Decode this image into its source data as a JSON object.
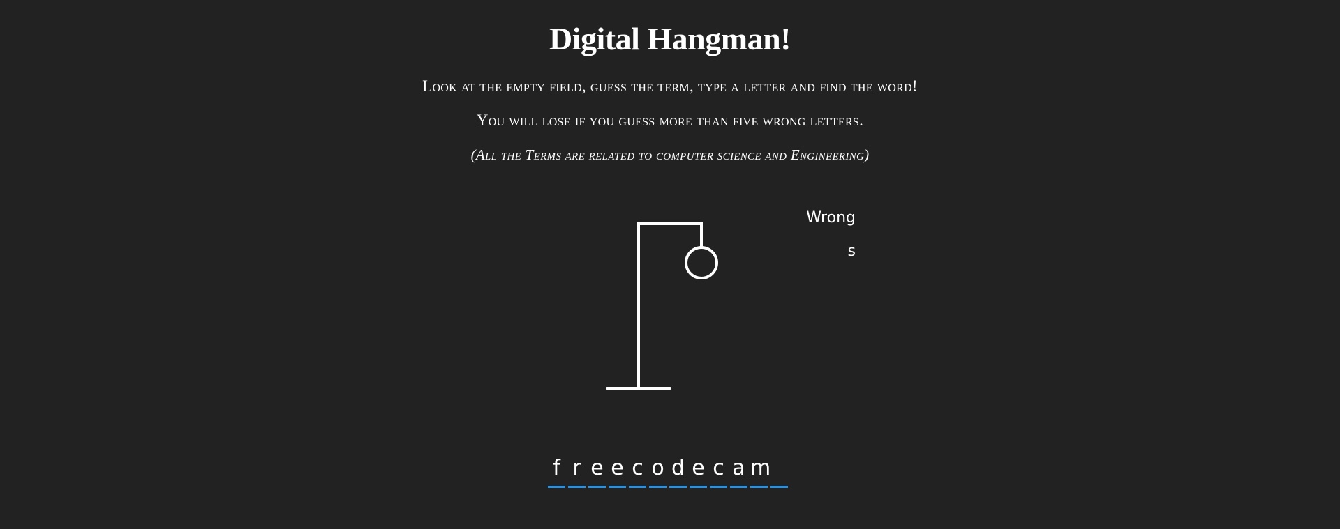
{
  "header": {
    "title": "Digital Hangman!",
    "instruction_1": "Look at the empty field, guess the term, type a letter and find the word!",
    "instruction_2": "You will lose if you guess more than five wrong letters.",
    "note": "(All the Terms are related to computer science and Engineering)"
  },
  "wrong": {
    "label": "Wrong",
    "letters": "s"
  },
  "word": {
    "letters": [
      "f",
      "r",
      "e",
      "e",
      "c",
      "o",
      "d",
      "e",
      "c",
      "a",
      "m",
      ""
    ],
    "underline_color": "#2f8fd8"
  },
  "hangman": {
    "wrong_count": 1,
    "max_wrong": 5,
    "parts_visible": [
      "head"
    ]
  },
  "colors": {
    "background": "#222222",
    "foreground": "#ffffff",
    "accent": "#2f8fd8"
  }
}
